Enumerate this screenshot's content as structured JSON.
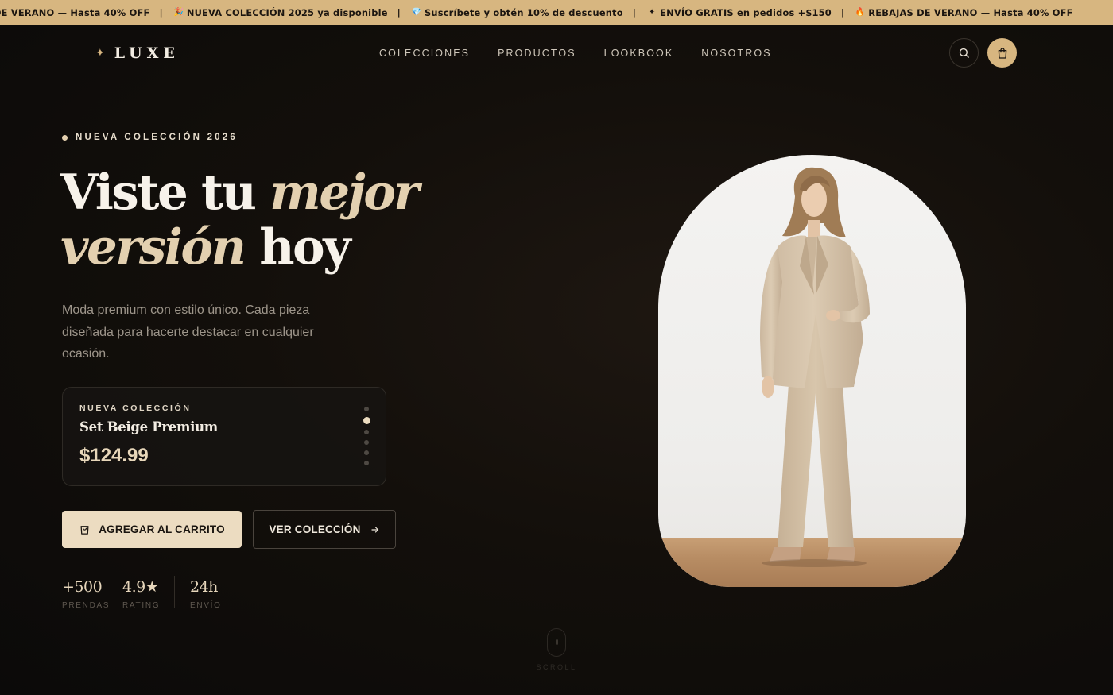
{
  "ticker": {
    "items": [
      {
        "emoji": "",
        "text": "DE VERANO — Hasta 40% OFF"
      },
      {
        "emoji": "🎉",
        "text": "NUEVA COLECCIÓN 2025 ya disponible"
      },
      {
        "emoji": "💎",
        "text": "Suscríbete y obtén 10% de descuento"
      },
      {
        "emoji": "✦",
        "text": "ENVÍO GRATIS en pedidos +$150"
      },
      {
        "emoji": "🔥",
        "text": "REBAJAS DE VERANO — Hasta 40% OFF"
      }
    ],
    "separator": "|",
    "background": "#d7b680"
  },
  "nav": {
    "logo_mark": "✦",
    "logo_text": "LUXE",
    "links": [
      "COLECCIONES",
      "PRODUCTOS",
      "LOOKBOOK",
      "NOSOTROS"
    ],
    "search_icon": "search-icon",
    "cart_icon": "shopping-bag-icon"
  },
  "hero": {
    "eyebrow": "NUEVA COLECCIÓN 2026",
    "headline": {
      "part1": "Viste tu",
      "highlight1": "mejor",
      "highlight2": "versión",
      "part2": "hoy"
    },
    "description": "Moda premium con estilo único. Cada pieza diseñada para hacerte destacar en cualquier ocasión."
  },
  "product_card": {
    "eyebrow": "NUEVA COLECCIÓN",
    "name": "Set Beige Premium",
    "price": "$124.99",
    "active_slide": 1,
    "slide_count": 6
  },
  "actions": {
    "add_to_cart": "AGREGAR AL CARRITO",
    "view_collection": "VER COLECCIÓN"
  },
  "stats": [
    {
      "value": "+500",
      "label": "PRENDAS"
    },
    {
      "value": "4.9★",
      "label": "RATING"
    },
    {
      "value": "24h",
      "label": "ENVÍO"
    }
  ],
  "scroll": {
    "label": "SCROLL"
  },
  "colors": {
    "accent": "#d7b680",
    "accent_light": "#ecdcc1",
    "background": "#0f0c0a"
  }
}
